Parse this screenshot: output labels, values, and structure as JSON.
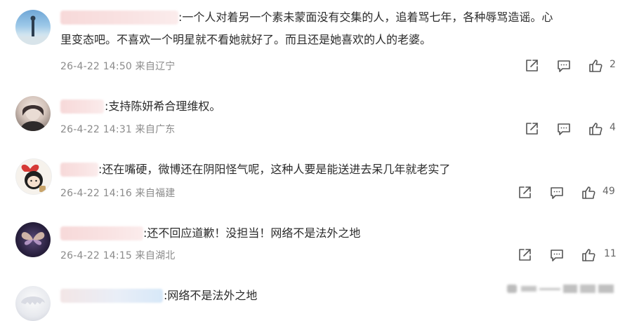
{
  "comments": [
    {
      "text_line1": ":一个人对着另一个素未蒙面没有交集的人，追着骂七年，各种辱骂造谣。心",
      "text_line2": "里变态吧。不喜欢一个明星就不看她就好了。而且还是她喜欢的人的老婆。",
      "meta": "26-4-22 14:50 来自辽宁",
      "likes": "2"
    },
    {
      "text_line1": ":支持陈妍希合理维权。",
      "meta": "26-4-22 14:31 来自广东",
      "likes": "4"
    },
    {
      "text_line1": ":还在嘴硬，微博还在阴阳怪气呢，这种人要是能送进去呆几年就老实了",
      "meta": "26-4-22 14:16 来自福建",
      "likes": "49"
    },
    {
      "text_line1": ":还不回应道歉！没担当！网络不是法外之地",
      "meta": "26-4-22 14:15 来自湖北",
      "likes": "11"
    },
    {
      "text_line1": ":网络不是法外之地"
    }
  ],
  "icons": {
    "share": "share-icon",
    "comment": "comment-icon",
    "like": "thumbs-up-icon"
  },
  "colors": {
    "text": "#2b2b2b",
    "meta": "#8b8b8b",
    "icon": "#555555"
  }
}
